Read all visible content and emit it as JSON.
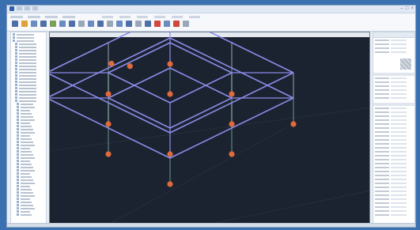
{
  "colors": {
    "desktop": "#3a6fb0",
    "viewport_background": "#1c2330",
    "beam_color": "#8a8ce8",
    "column_color": "#d8d8e6",
    "support_color": "#e06a3c",
    "pile_line_color": "#9de8c6"
  },
  "window": {
    "title": ""
  },
  "icons": {
    "app": "app-icon",
    "minimize": "minimize-icon",
    "maximize": "maximize-icon",
    "close": "close-icon"
  }
}
